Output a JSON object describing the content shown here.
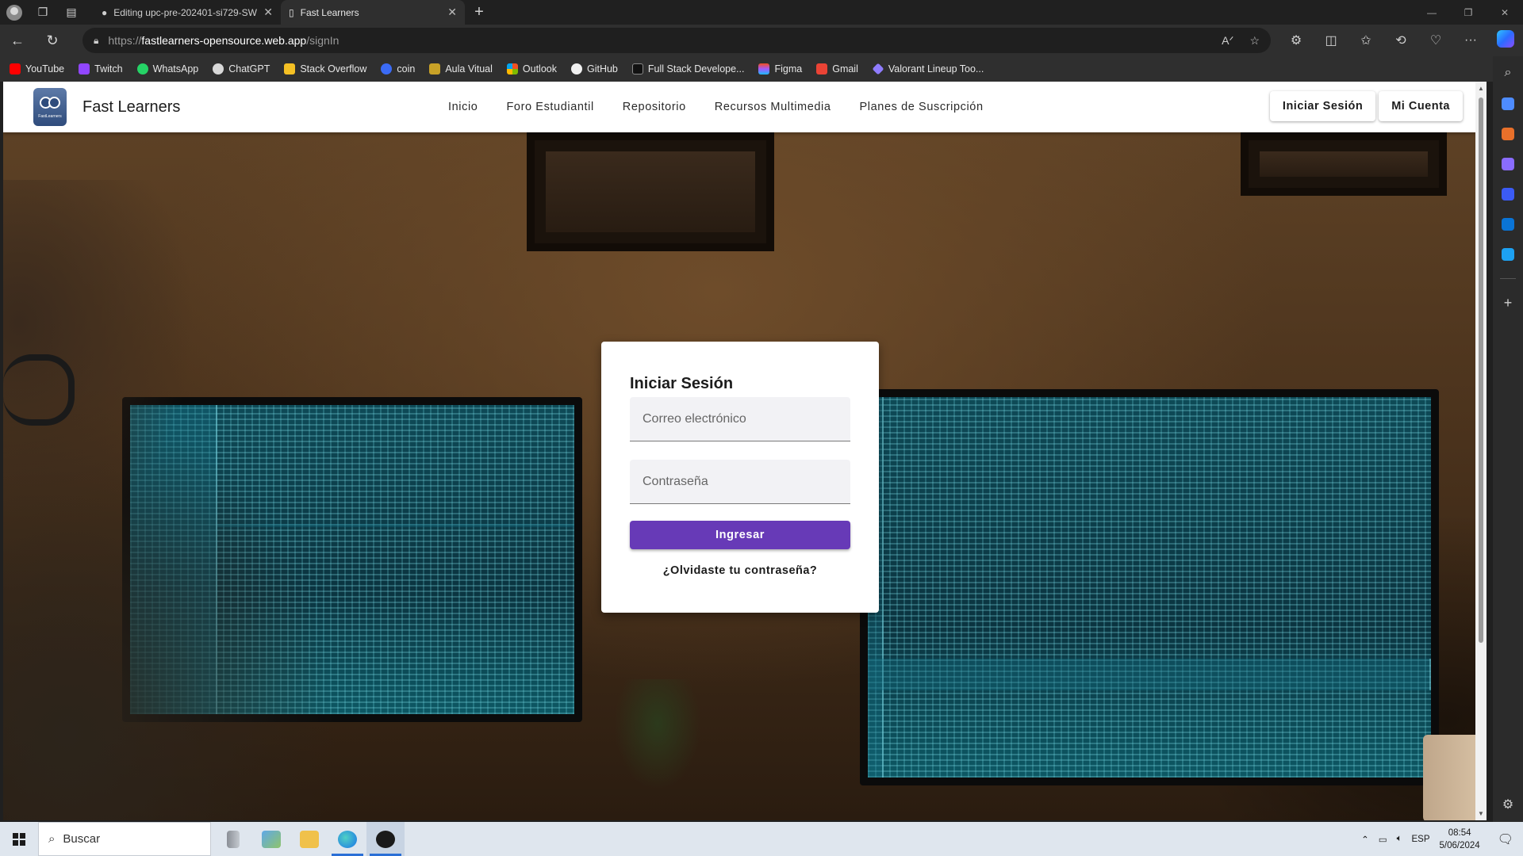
{
  "browser": {
    "tabs": [
      {
        "title": "Editing upc-pre-202401-si729-SW",
        "icon": "github-icon"
      },
      {
        "title": "Fast Learners",
        "icon": "page-icon"
      }
    ],
    "url": {
      "proto": "https://",
      "host": "fastlearners-opensource.web.app",
      "path": "/signIn"
    },
    "bookmarks": [
      {
        "label": "YouTube",
        "color": "#ff0000"
      },
      {
        "label": "Twitch",
        "color": "#9146ff"
      },
      {
        "label": "WhatsApp",
        "color": "#25d366"
      },
      {
        "label": "ChatGPT",
        "color": "#d8d8d8"
      },
      {
        "label": "Stack Overflow",
        "color": "#f48024"
      },
      {
        "label": "coin",
        "color": "#3b6bf5"
      },
      {
        "label": "Aula Vitual",
        "color": "#c9a227"
      },
      {
        "label": "Outlook",
        "color": "#f25022"
      },
      {
        "label": "GitHub",
        "color": "#f0f0f0"
      },
      {
        "label": "Full Stack Develope...",
        "color": "#111111"
      },
      {
        "label": "Figma",
        "color": "#a259ff"
      },
      {
        "label": "Gmail",
        "color": "#ea4335"
      },
      {
        "label": "Valorant Lineup Too...",
        "color": "#8f7cff"
      }
    ]
  },
  "site": {
    "brand": "Fast Learners",
    "logo_text": "FastLearners",
    "nav": [
      "Inicio",
      "Foro Estudiantil",
      "Repositorio",
      "Recursos Multimedia",
      "Planes de Suscripción"
    ],
    "account": {
      "signin": "Iniciar Sesión",
      "my_account": "Mi Cuenta"
    }
  },
  "login": {
    "title": "Iniciar Sesión",
    "email_placeholder": "Correo electrónico",
    "email_value": "",
    "password_placeholder": "Contraseña",
    "password_value": "",
    "submit": "Ingresar",
    "forgot": "¿Olvidaste tu contraseña?",
    "accent": "#673ab7"
  },
  "taskbar": {
    "search_placeholder": "Buscar",
    "language": "ESP",
    "time": "08:54",
    "date": "5/06/2024"
  }
}
